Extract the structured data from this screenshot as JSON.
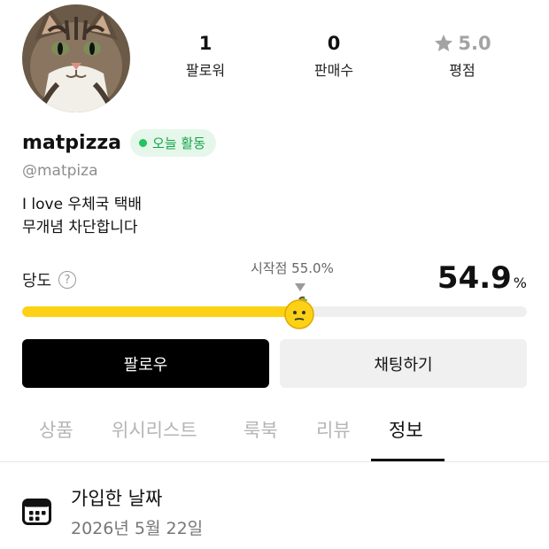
{
  "profile": {
    "avatar_alt": "cat photo",
    "username": "matpizza",
    "handle": "@matpiza",
    "active_badge": "오늘 활동",
    "bio_lines": [
      "I love 우체국 택배",
      "무개념 차단합니다"
    ]
  },
  "stats": {
    "followers": {
      "value": "1",
      "label": "팔로워"
    },
    "sales": {
      "value": "0",
      "label": "판매수"
    },
    "rating": {
      "value": "5.0",
      "label": "평점",
      "icon": "star-icon"
    }
  },
  "sweetness": {
    "label": "당도",
    "help_icon": "question-circle-icon",
    "start_label": "시작점 55.0%",
    "value": "54.9",
    "unit": "%",
    "fill_percent": 54.9,
    "knob_icon": "apple-face-icon",
    "fill_color": "#fcd116"
  },
  "buttons": {
    "follow": "팔로우",
    "chat": "채팅하기"
  },
  "tabs": [
    {
      "label": "상품",
      "active": false
    },
    {
      "label": "위시리스트",
      "active": false
    },
    {
      "label": "룩북",
      "active": false
    },
    {
      "label": "리뷰",
      "active": false
    },
    {
      "label": "정보",
      "active": true
    }
  ],
  "info": {
    "icon": "calendar-icon",
    "title": "가입한 날짜",
    "value": "2026년 5월 22일"
  },
  "colors": {
    "active_green": "#16a34a",
    "rating_gray": "#a3a3a3",
    "primary_black": "#000000"
  }
}
